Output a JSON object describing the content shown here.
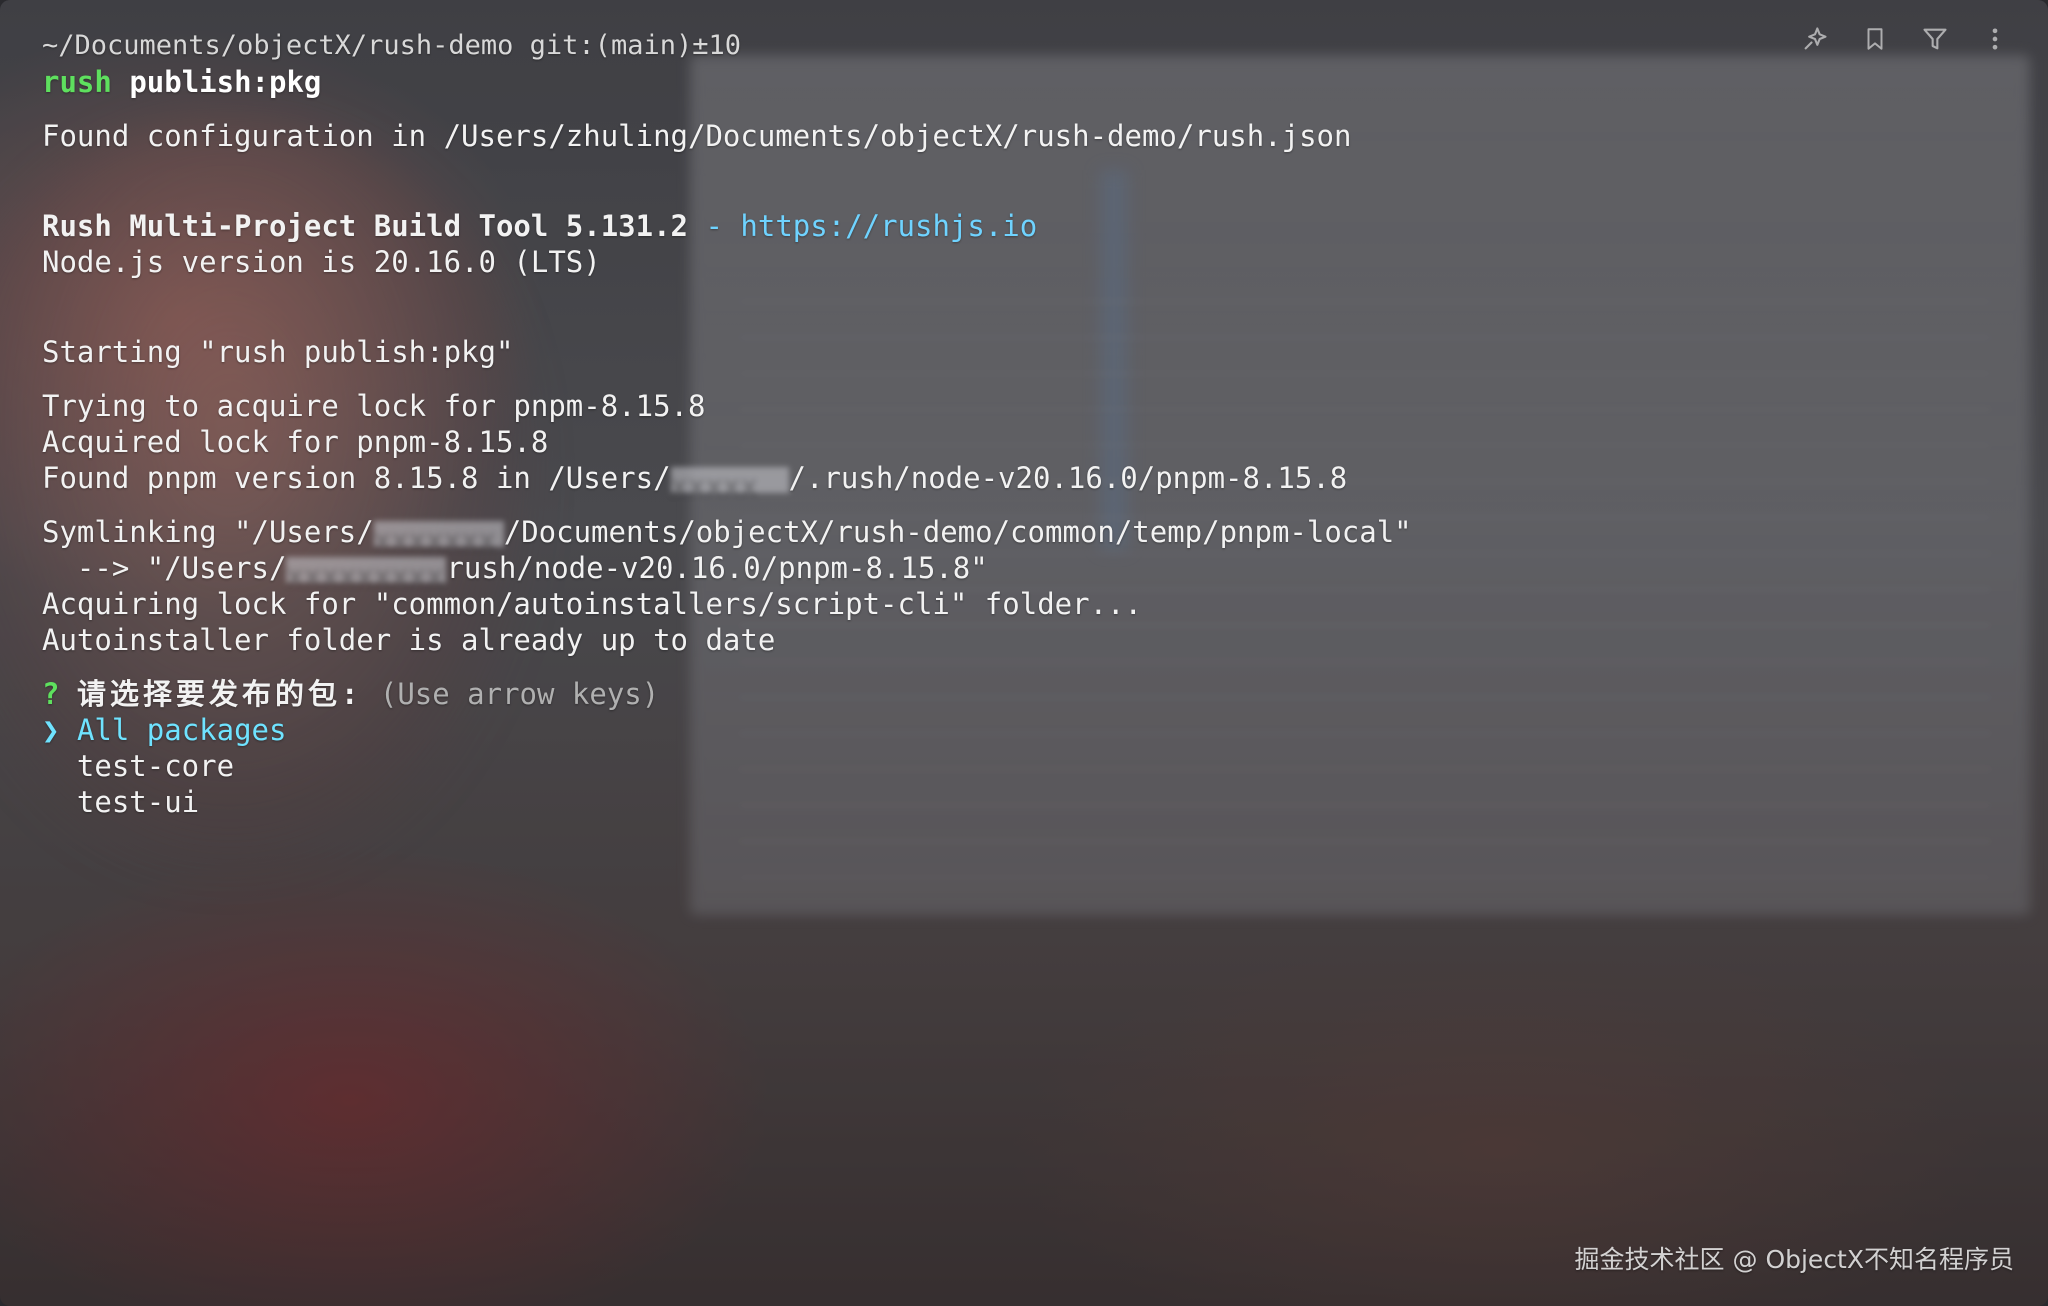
{
  "toolbar": {
    "icons": [
      "sparkle-pin-icon",
      "bookmark-icon",
      "filter-icon",
      "more-vertical-icon"
    ]
  },
  "terminal": {
    "prompt_path": "~/Documents/objectX/rush-demo git:(main)±10",
    "command": {
      "bin": "rush",
      "arg": "publish:pkg"
    },
    "found_config": "Found configuration in /Users/zhuling/Documents/objectX/rush-demo/rush.json",
    "rush_title": "Rush Multi-Project Build Tool 5.131.2",
    "rush_sep": " - ",
    "rush_url": "https://rushjs.io",
    "node_version": "Node.js version is 20.16.0 (LTS)",
    "starting": "Starting \"rush publish:pkg\"",
    "trying_lock": "Trying to acquire lock for pnpm-8.15.8",
    "acquired_lock": "Acquired lock for pnpm-8.15.8",
    "found_pnpm_prefix": "Found pnpm version 8.15.8 in /Users/",
    "found_pnpm_suffix": "/.rush/node-v20.16.0/pnpm-8.15.8",
    "symlink_prefix": "Symlinking \"/Users/",
    "symlink_suffix": "/Documents/objectX/rush-demo/common/temp/pnpm-local\"",
    "arrow_prefix": "  --> \"/Users/",
    "arrow_suffix": "rush/node-v20.16.0/pnpm-8.15.8\"",
    "acquiring_lock": "Acquiring lock for \"common/autoinstallers/script-cli\" folder...",
    "autoinstaller": "Autoinstaller folder is already up to date",
    "question_mark": "?",
    "question": "请选择要发布的包:",
    "question_hint": "(Use arrow keys)",
    "pointer": "❯",
    "options": [
      "All packages",
      "test-core",
      "test-ui"
    ]
  },
  "watermark": "掘金技术社区 @ ObjectX不知名程序员"
}
